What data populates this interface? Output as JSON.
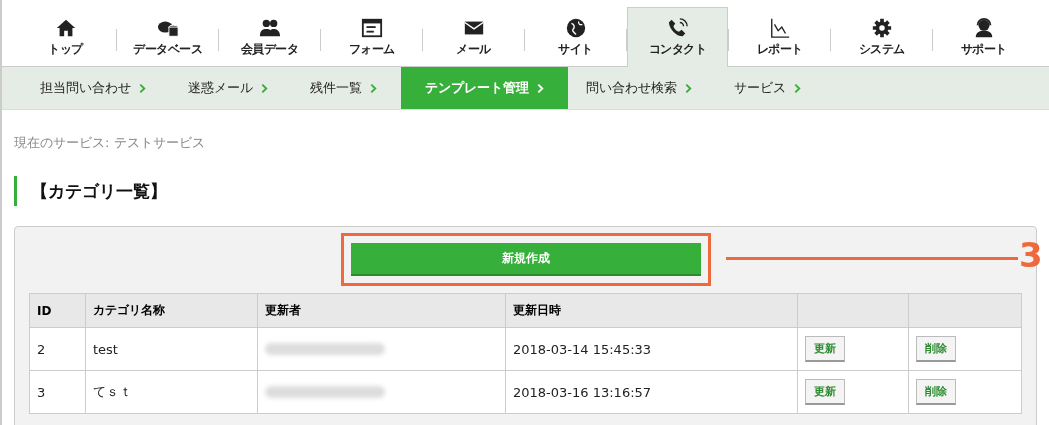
{
  "main_nav": [
    {
      "label": "トップ",
      "selected": false
    },
    {
      "label": "データベース",
      "selected": false
    },
    {
      "label": "会員データ",
      "selected": false
    },
    {
      "label": "フォーム",
      "selected": false
    },
    {
      "label": "メール",
      "selected": false
    },
    {
      "label": "サイト",
      "selected": false
    },
    {
      "label": "コンタクト",
      "selected": true
    },
    {
      "label": "レポート",
      "selected": false
    },
    {
      "label": "システム",
      "selected": false
    },
    {
      "label": "サポート",
      "selected": false
    }
  ],
  "sub_nav": [
    {
      "label": "担当問い合わせ",
      "selected": false
    },
    {
      "label": "迷惑メール",
      "selected": false
    },
    {
      "label": "残件一覧",
      "selected": false
    },
    {
      "label": "テンプレート管理",
      "selected": true
    },
    {
      "label": "問い合わせ検索",
      "selected": false
    },
    {
      "label": "サービス",
      "selected": false
    }
  ],
  "current_service": "現在のサービス: テストサービス",
  "heading": "【カテゴリ一覧】",
  "new_button": "新規作成",
  "annotation": {
    "label": "3"
  },
  "table": {
    "columns": [
      "ID",
      "カテゴリ名称",
      "更新者",
      "更新日時"
    ],
    "rows": [
      {
        "id": "2",
        "name": "test",
        "updated": "2018-03-14 15:45:33",
        "actions": [
          "更新",
          "削除"
        ]
      },
      {
        "id": "3",
        "name": "てｓｔ",
        "updated": "2018-03-16 13:16:57",
        "actions": [
          "更新",
          "削除"
        ]
      }
    ]
  }
}
